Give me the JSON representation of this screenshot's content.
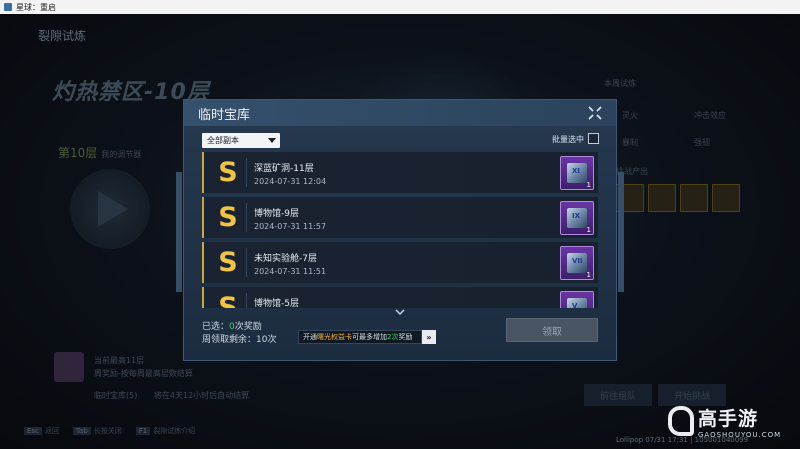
{
  "window": {
    "title": "星球：重启"
  },
  "background": {
    "section_title": "裂隙试炼",
    "zone_title": "灼热禁区-10层",
    "floor_label": "第10层",
    "floor_sub": "我的调节器",
    "right_panel": {
      "search_label": "本周试炼",
      "item1": "灵火",
      "item2": "冲击效应",
      "item3": "暴制",
      "item4": "强韧",
      "section": "挑战产出"
    },
    "left_info": {
      "line1": "当前最高11层",
      "line2": "周奖励-按每周最高层数结算"
    },
    "treasure_line": "临时宝库(5)",
    "treasure_note": "将在4天12小时后自动结算",
    "btn_team": "前往组队",
    "btn_start": "开始挑战",
    "footer": [
      {
        "key": "Esc",
        "label": "返回"
      },
      {
        "key": "Tab",
        "label": "长按关闭"
      },
      {
        "key": "F1",
        "label": "裂隙试炼介绍"
      }
    ],
    "status": "Lollipop  07/31 17:31 | 105001040099"
  },
  "watermark": {
    "brand": "高手游",
    "url": "GAOSHOUYOU.COM"
  },
  "modal": {
    "title": "临时宝库",
    "filter": {
      "selected": "全部副本"
    },
    "batch_select_label": "批量选中",
    "items": [
      {
        "badge": "S",
        "name": "深蓝矿洞-11层",
        "time": "2024-07-31 12:04",
        "reward_tier": "XI",
        "reward_qty": "1"
      },
      {
        "badge": "S",
        "name": "博物馆-9层",
        "time": "2024-07-31 11:57",
        "reward_tier": "IX",
        "reward_qty": "1"
      },
      {
        "badge": "S",
        "name": "未知实验舱-7层",
        "time": "2024-07-31 11:51",
        "reward_tier": "VII",
        "reward_qty": "1"
      },
      {
        "badge": "S",
        "name": "博物馆-5层",
        "time": "",
        "reward_tier": "V",
        "reward_qty": "1"
      }
    ],
    "selected_label": "已选：",
    "selected_count": "0",
    "selected_suffix": "次奖励",
    "weekly_label": "周领取剩余：",
    "weekly_value": "10次",
    "promo": {
      "prefix": "开通",
      "card": "曙光权益卡",
      "middle": "可最多增加",
      "amount": "2次",
      "suffix": "奖励"
    },
    "claim_label": "领取"
  },
  "colors": {
    "accent_gold": "#f2c443",
    "count_green": "#3fcf5e",
    "reward_purple": "#6a34a5"
  }
}
